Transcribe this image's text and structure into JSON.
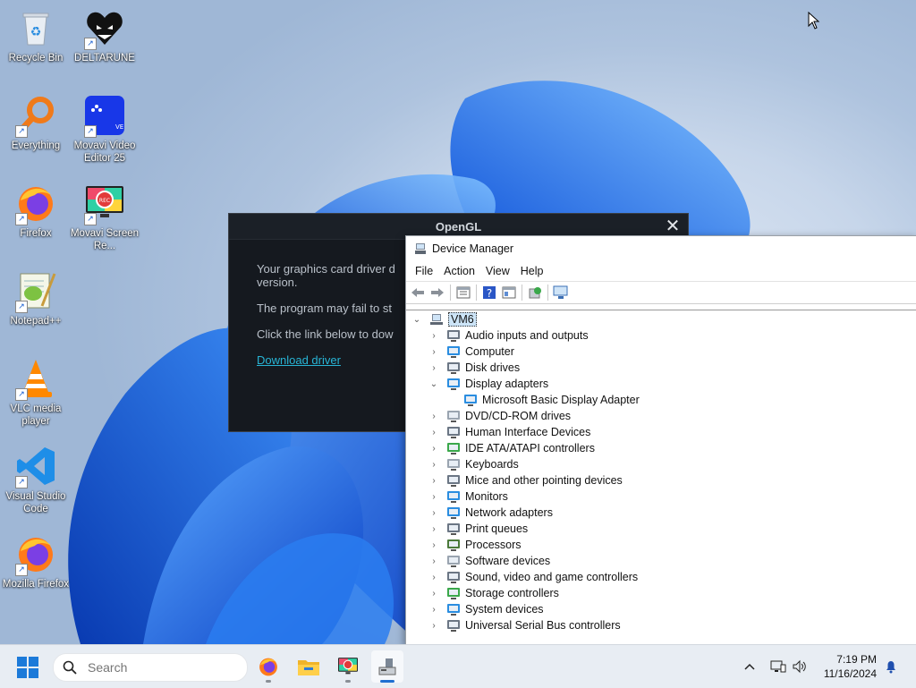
{
  "desktop": {
    "icons": [
      {
        "label": "Recycle Bin",
        "icon": "recycle-bin-icon"
      },
      {
        "label": "DELTARUNE",
        "icon": "deltarune-icon"
      },
      {
        "label": "Everything",
        "icon": "everything-search-icon"
      },
      {
        "label": "Movavi Video Editor 25",
        "icon": "movavi-video-editor-icon"
      },
      {
        "label": "Firefox",
        "icon": "firefox-icon"
      },
      {
        "label": "Movavi Screen Re...",
        "icon": "movavi-screen-recorder-icon"
      },
      {
        "label": "Notepad++",
        "icon": "notepad-plus-plus-icon"
      },
      {
        "label": "VLC media player",
        "icon": "vlc-icon"
      },
      {
        "label": "Visual Studio Code",
        "icon": "vscode-icon"
      },
      {
        "label": "Mozilla Firefox",
        "icon": "firefox-icon"
      }
    ]
  },
  "opengl_dialog": {
    "title": "OpenGL",
    "close_glyph": "✕",
    "lines": [
      "Your graphics card driver d",
      "version.",
      "The program may fail to st",
      "Click the link below to dow"
    ],
    "link": "Download driver"
  },
  "device_manager": {
    "title": "Device Manager",
    "menu": [
      "File",
      "Action",
      "View",
      "Help"
    ],
    "root": "VM6",
    "categories": [
      {
        "label": "Audio inputs and outputs",
        "expanded": false
      },
      {
        "label": "Computer",
        "expanded": false
      },
      {
        "label": "Disk drives",
        "expanded": false
      },
      {
        "label": "Display adapters",
        "expanded": true
      },
      {
        "label": "Microsoft Basic Display Adapter",
        "child": true
      },
      {
        "label": "DVD/CD-ROM drives",
        "expanded": false
      },
      {
        "label": "Human Interface Devices",
        "expanded": false
      },
      {
        "label": "IDE ATA/ATAPI controllers",
        "expanded": false
      },
      {
        "label": "Keyboards",
        "expanded": false
      },
      {
        "label": "Mice and other pointing devices",
        "expanded": false
      },
      {
        "label": "Monitors",
        "expanded": false
      },
      {
        "label": "Network adapters",
        "expanded": false
      },
      {
        "label": "Print queues",
        "expanded": false
      },
      {
        "label": "Processors",
        "expanded": false
      },
      {
        "label": "Software devices",
        "expanded": false
      },
      {
        "label": "Sound, video and game controllers",
        "expanded": false
      },
      {
        "label": "Storage controllers",
        "expanded": false
      },
      {
        "label": "System devices",
        "expanded": false
      },
      {
        "label": "Universal Serial Bus controllers",
        "expanded": false
      }
    ]
  },
  "taskbar": {
    "search_placeholder": "Search",
    "apps": [
      "firefox-icon",
      "file-explorer-icon",
      "movavi-screen-recorder-icon",
      "device-manager-icon"
    ],
    "time": "7:19 PM",
    "date": "11/16/2024"
  },
  "colors": {
    "accent": "#1f6fd1",
    "link": "#28b5d6",
    "dialog_bg": "#15191f"
  }
}
